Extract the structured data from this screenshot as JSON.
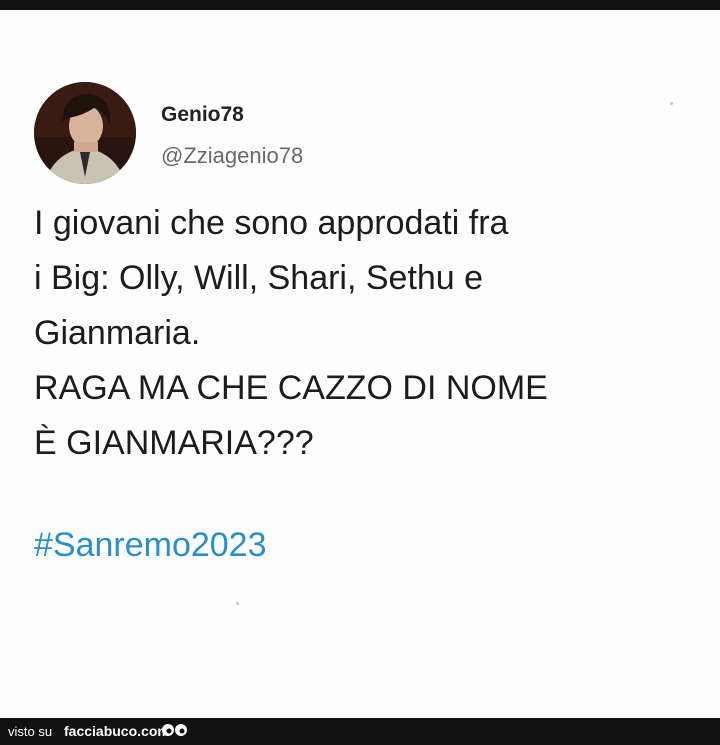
{
  "tweet": {
    "display_name": "Genio78",
    "handle": "@Zziagenio78",
    "text": "I giovani che sono approdati fra\ni Big: Olly, Will, Shari, Sethu e\nGianmaria.\nRAGA MA CHE CAZZO DI NOME\nÈ GIANMARIA???",
    "hashtag": "#Sanremo2023"
  },
  "footer": {
    "visto_label": "visto su",
    "brand": "facciabuco.com",
    "logo_icon": "eyes-icon"
  },
  "colors": {
    "hashtag": "#2a8fc9",
    "handle": "#666a70",
    "footer_bg": "#111111"
  }
}
